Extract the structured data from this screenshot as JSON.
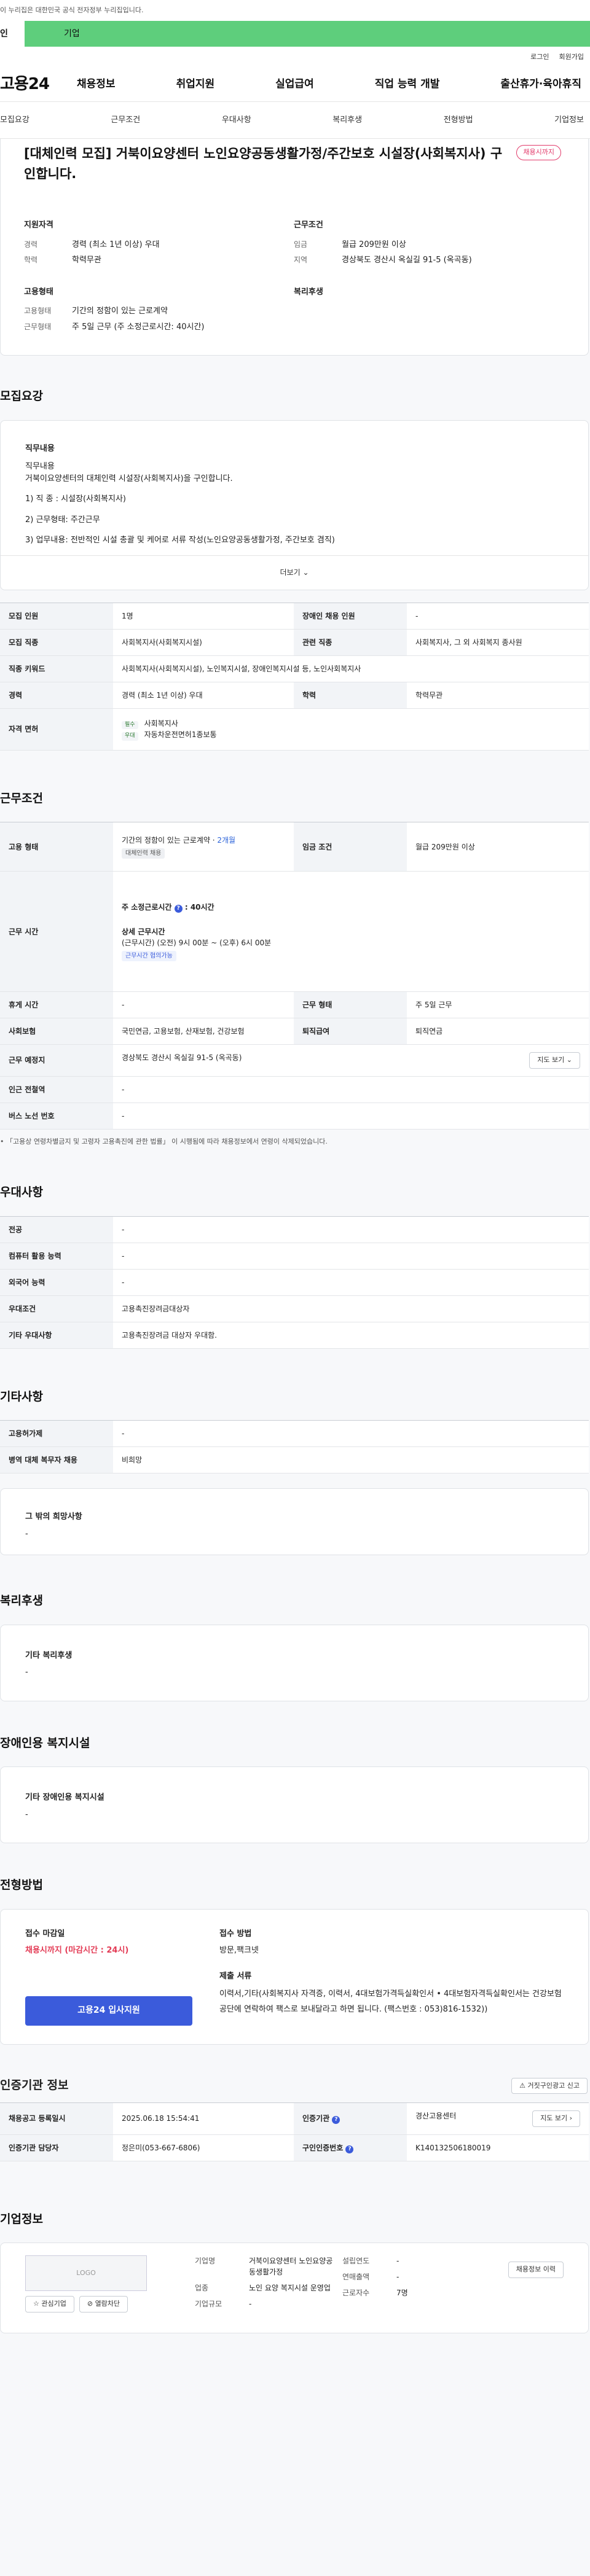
{
  "topbar": {
    "notice": "이 누리집은 대한민국 공식 전자정부 누리집입니다."
  },
  "tabs": {
    "individual": "인",
    "company": "기업"
  },
  "util": {
    "login": "로그인",
    "join": "회원가입"
  },
  "gnb": {
    "logo": "고용24",
    "menu": [
      "채용정보",
      "취업지원",
      "실업급여",
      "직업 능력 개발",
      "출산휴가·육아휴직"
    ]
  },
  "snb": [
    "모집요강",
    "근무조건",
    "우대사항",
    "복리후생",
    "전형방법",
    "기업정보"
  ],
  "header": {
    "title": "[대체인력 모집] 거북이요양센터 노인요양공동생활가정/주간보호 시설장(사회복지사) 구인합니다.",
    "fav": "채용시까지",
    "qual_h": "지원자격",
    "qual": [
      {
        "k": "경력",
        "v": "경력 (최소 1년 이상) 우대"
      },
      {
        "k": "학력",
        "v": "학력무관"
      }
    ],
    "cond_h": "근무조건",
    "cond": [
      {
        "k": "임금",
        "v": "월급 209만원 이상"
      },
      {
        "k": "지역",
        "v": "경상북도 경산시 옥실길 91-5 (옥곡동)"
      }
    ],
    "emp_h": "고용형태",
    "emp": [
      {
        "k": "고용형태",
        "v": "기간의 정함이 있는 근로계약"
      },
      {
        "k": "근무형태",
        "v": "주 5일 근무 (주 소정근로시간: 40시간)"
      }
    ],
    "welfare_h": "복리후생"
  },
  "sections": {
    "recruit": "모집요강",
    "work": "근무조건",
    "pref": "우대사항",
    "etc": "기타사항",
    "welfare": "복리후생",
    "disabled": "장애인용 복지시설",
    "screen": "전형방법",
    "cert": "인증기관 정보",
    "company": "기업정보"
  },
  "job_desc": {
    "label": "직무내용",
    "lines": [
      "직무내용",
      "거북이요양센터의 대체인력 시설장(사회복지사)을 구인합니다.",
      "1) 직 종 : 시설장(사회복지사)",
      "2) 근무형태: 주간근무",
      "3) 업무내용: 전반적인 시설 총괄 및 케어로 서류 작성(노인요양공동생활가정, 주간보호 겸직)"
    ],
    "more": "더보기"
  },
  "recruit_table": {
    "count_k": "모집 인원",
    "count_v": "1명",
    "disabled_k": "장애인 채용 인원",
    "disabled_v": "-",
    "job_k": "모집 직종",
    "job_v": "사회복지사(사회복지시설)",
    "related_k": "관련 직종",
    "related_v": "사회복지사, 그 외 사회복지 종사원",
    "keyword_k": "직종 키워드",
    "keyword_v": "사회복지사(사회복지시설), 노인복지시설, 장애인복지시설 등, 노인사회복지사",
    "career_k": "경력",
    "career_v": "경력 (최소 1년 이상) 우대",
    "edu_k": "학력",
    "edu_v": "학력무관",
    "license_k": "자격 면허",
    "licenses": [
      {
        "badge": "필수",
        "name": "사회복지사"
      },
      {
        "badge": "우대",
        "name": "자동차운전면허1종보통"
      }
    ]
  },
  "work_table": {
    "emp_k": "고용 형태",
    "emp_v": "기간의 정함이 있는 근로계약 · ",
    "emp_period": "2개월",
    "emp_badge": "대체인력 채용",
    "wage_k": "임금 조건",
    "wage_v": "월급 209만원 이상",
    "time_k": "근무 시간",
    "time_weekly": "주 소정근로시간",
    "time_hours": "40시간",
    "time_detail_h": "상세 근무시간",
    "time_detail": "(근무시간) (오전) 9시 00분 ~ (오후) 6시 00분",
    "time_badge": "근무시간 협의가능",
    "rest_k": "휴게 시간",
    "rest_v": "-",
    "type_k": "근무 형태",
    "type_v": "주 5일 근무",
    "ins_k": "사회보험",
    "ins_v": "국민연금, 고용보험, 산재보험, 건강보험",
    "retire_k": "퇴직급여",
    "retire_v": "퇴직연금",
    "place_k": "근무 예정지",
    "place_v": "경상북도 경산시 옥실길 91-5 (옥곡동)",
    "map_btn": "지도 보기",
    "subway_k": "인근 전철역",
    "subway_v": "-",
    "bus_k": "버스 노선 번호",
    "bus_v": "-",
    "note": "• 「고용상 연령차별금지 및 고령자 고용촉진에 관한 법률」 이 시행됨에 따라 채용정보에서 연령이 삭제되었습니다."
  },
  "pref_table": [
    {
      "k": "전공",
      "v": "-"
    },
    {
      "k": "컴퓨터 활용 능력",
      "v": "-"
    },
    {
      "k": "외국어 능력",
      "v": "-"
    },
    {
      "k": "우대조건",
      "v": "고용촉진장려금대상자"
    },
    {
      "k": "기타 우대사항",
      "v": "고용촉진장려금 대상자 우대함."
    }
  ],
  "etc_table": [
    {
      "k": "고용허가제",
      "v": "-"
    },
    {
      "k": "병역 대체 복무자 채용",
      "v": "비희망"
    }
  ],
  "etc_box": {
    "title": "그 밖의 희망사항",
    "value": "-"
  },
  "welfare_box": {
    "title": "기타 복리후생",
    "value": "-"
  },
  "disabled_box": {
    "title": "기타 장애인용 복지시설",
    "value": "-"
  },
  "screen": {
    "deadline_h": "접수 마감일",
    "deadline": "채용시까지 (마감시간 : 24시)",
    "apply_btn": "고용24 입사지원",
    "method_h": "접수 방법",
    "method": "방문,팩크넷",
    "docs_h": "제출 서류",
    "docs": "이력서,기타(사회복지사 자격증, 이력서, 4대보험가격득실확인서 • 4대보험자격득실확인서는 건강보험공단에 연락하여 팩스로 보내달라고 하면 됩니다. (팩스번호 : 053)816-1532))"
  },
  "cert": {
    "report_btn": "거짓구인광고 신고",
    "reg_k": "채용공고 등록일시",
    "reg_v": "2025.06.18 15:54:41",
    "org_k": "인증기관",
    "org_v": "경산고용센터",
    "map_btn": "지도 보기",
    "mgr_k": "인증기관 담당자",
    "mgr_v": "정은미(053-667-6806)",
    "no_k": "구인인증번호",
    "no_v": "K140132506180019"
  },
  "company": {
    "logo": "LOGO",
    "fav_btn": "관심기업",
    "block_btn": "열람차단",
    "history_btn": "채용정보 이력",
    "name_k": "기업명",
    "name_v": "거북이요양센터 노인요양공동생활가정",
    "biz_k": "업종",
    "biz_v": "노인 요양 복지시설 운영업",
    "scale_k": "기업규모",
    "scale_v": "-",
    "est_k": "설립연도",
    "est_v": "-",
    "sales_k": "연매출액",
    "sales_v": "-",
    "emp_k": "근로자수",
    "emp_v": "7명"
  }
}
